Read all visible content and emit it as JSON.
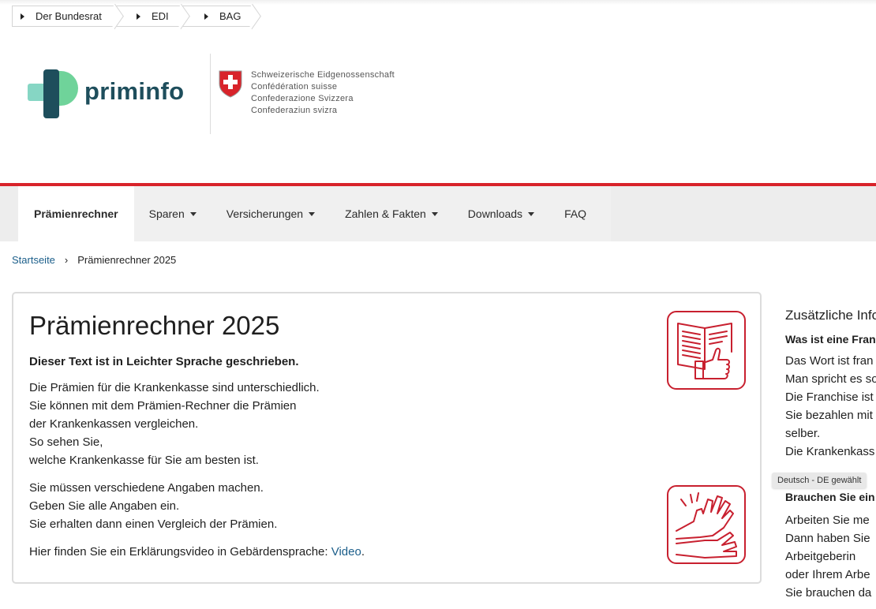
{
  "top_breadcrumb": [
    "Der Bundesrat",
    "EDI",
    "BAG"
  ],
  "brand": {
    "logo_text": "priminfo",
    "confederation_lines": [
      "Schweizerische Eidgenossenschaft",
      "Confédération suisse",
      "Confederazione Svizzera",
      "Confederaziun svizra"
    ],
    "colors": {
      "accent_red": "#d8232a",
      "logo_teal": "#1e4e5c",
      "logo_green": "#6fd39a",
      "logo_mint": "#86d6c4"
    }
  },
  "nav": {
    "items": [
      {
        "label": "Prämienrechner",
        "active": true,
        "dropdown": false
      },
      {
        "label": "Sparen",
        "active": false,
        "dropdown": true
      },
      {
        "label": "Versicherungen",
        "active": false,
        "dropdown": true
      },
      {
        "label": "Zahlen & Fakten",
        "active": false,
        "dropdown": true
      },
      {
        "label": "Downloads",
        "active": false,
        "dropdown": true
      },
      {
        "label": "FAQ",
        "active": false,
        "dropdown": false
      }
    ]
  },
  "breadcrumb": {
    "home": "Startseite",
    "separator": "›",
    "current": "Prämienrechner 2025"
  },
  "card": {
    "title": "Prämienrechner 2025",
    "lead": "Dieser Text ist in Leichter Sprache geschrieben.",
    "para1": [
      "Die Prämien für die Krankenkasse sind unterschiedlich.",
      "Sie können mit dem Prämien-Rechner die Prämien",
      "der Krankenkassen vergleichen.",
      "So sehen Sie,",
      "welche Krankenkasse für Sie am besten ist."
    ],
    "para2": [
      "Sie müssen verschiedene Angaben machen.",
      "Geben Sie alle Angaben ein.",
      "Sie erhalten dann einen Vergleich der Prämien."
    ],
    "video_prefix": "Hier finden Sie ein Erklärungsvideo in Gebärdensprache: ",
    "video_link": "Video",
    "video_suffix": "."
  },
  "aside": {
    "title": "Zusätzliche Info",
    "h1": "Was ist eine Fran",
    "lines1": [
      "Das Wort ist fran",
      "Man spricht es so",
      "Die Franchise ist",
      "Sie bezahlen mit",
      "selber.",
      "Die Krankenkass"
    ],
    "h2": "Brauchen Sie ein",
    "lines2": [
      "Arbeiten Sie me",
      "Dann haben Sie",
      "Arbeitgeberin",
      "oder Ihrem Arbe",
      "Sie brauchen da"
    ]
  },
  "tooltip": "Deutsch - DE gewählt"
}
